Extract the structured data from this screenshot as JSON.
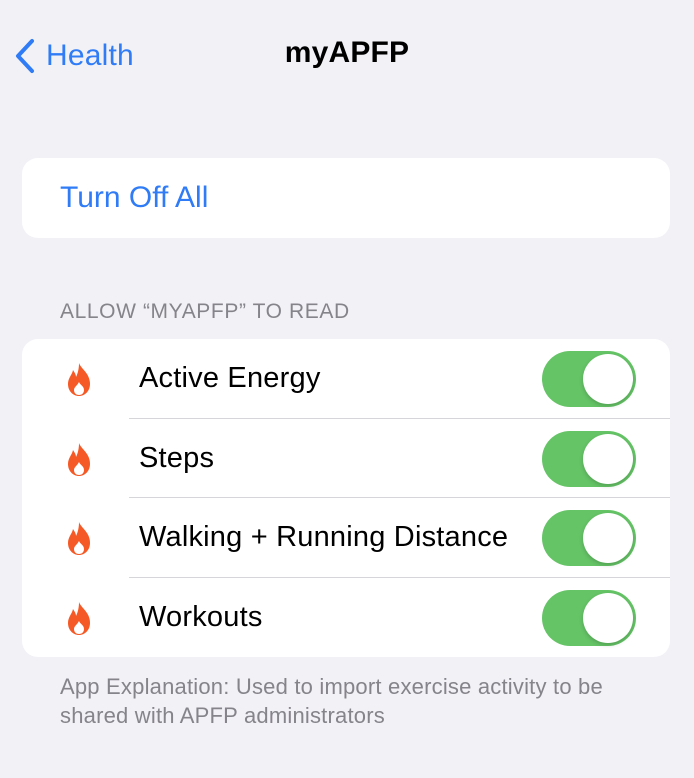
{
  "nav": {
    "back_label": "Health",
    "title": "myAPFP",
    "back_icon": "chevron-left-icon"
  },
  "turn_off_all": {
    "label": "Turn Off All"
  },
  "section": {
    "header": "ALLOW “MYAPFP” TO READ"
  },
  "items": [
    {
      "label": "Active Energy",
      "icon": "flame-icon",
      "enabled": true
    },
    {
      "label": "Steps",
      "icon": "flame-icon",
      "enabled": true
    },
    {
      "label": "Walking + Running Distance",
      "icon": "flame-icon",
      "enabled": true
    },
    {
      "label": "Workouts",
      "icon": "flame-icon",
      "enabled": true
    }
  ],
  "footer": {
    "text": "App Explanation: Used to import exercise activity to be shared with APFP administrators"
  },
  "colors": {
    "accent": "#2f7cf6",
    "toggle_on": "#65c466",
    "icon_orange": "#f55a26",
    "background": "#f2f1f6"
  }
}
